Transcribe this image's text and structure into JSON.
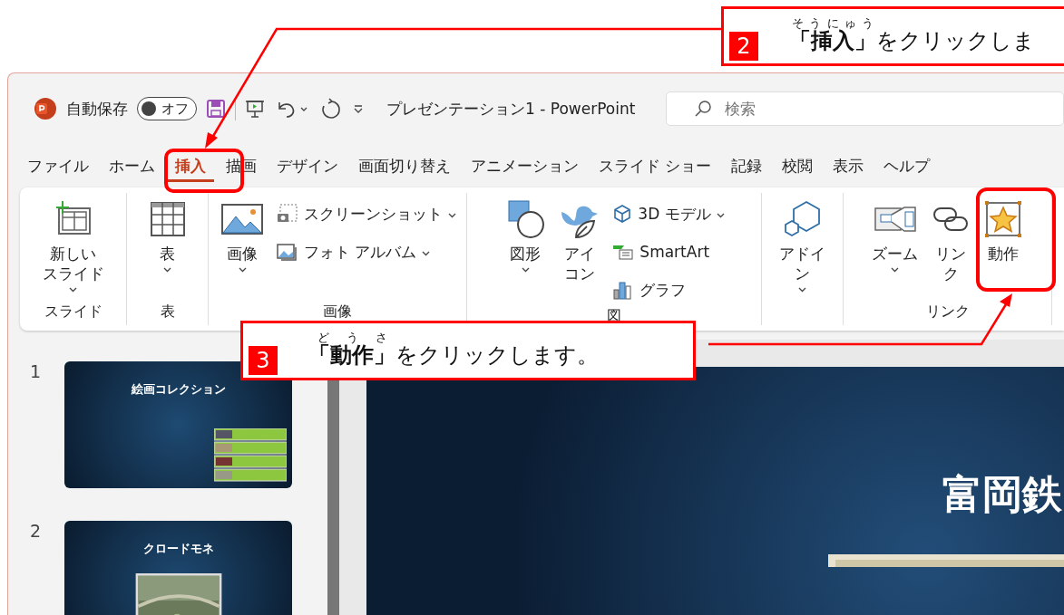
{
  "callouts": [
    {
      "number": "2",
      "ruby": "そうにゅう",
      "target": "「挿入」",
      "text": "をクリックしま"
    },
    {
      "number": "3",
      "ruby": "どうさ",
      "target": "「動作」",
      "text": "をクリックします。"
    }
  ],
  "title_bar": {
    "autosave_label": "自動保存",
    "autosave_toggle": {
      "label": "オフ",
      "on": false
    },
    "title": "プレゼンテーション1 - PowerPoint",
    "search": {
      "placeholder": "検索"
    }
  },
  "tabs": [
    {
      "label": "ファイル",
      "selected": false
    },
    {
      "label": "ホーム",
      "selected": false
    },
    {
      "label": "挿入",
      "selected": true
    },
    {
      "label": "描画",
      "selected": false
    },
    {
      "label": "デザイン",
      "selected": false
    },
    {
      "label": "画面切り替え",
      "selected": false
    },
    {
      "label": "アニメーション",
      "selected": false
    },
    {
      "label": "スライド ショー",
      "selected": false
    },
    {
      "label": "記録",
      "selected": false
    },
    {
      "label": "校閲",
      "selected": false
    },
    {
      "label": "表示",
      "selected": false
    },
    {
      "label": "ヘルプ",
      "selected": false
    }
  ],
  "ribbon": {
    "groups": [
      {
        "label": "スライド",
        "items": [
          {
            "kind": "large",
            "lines": [
              "新しい",
              "スライド"
            ],
            "dropdown": true
          }
        ]
      },
      {
        "label": "表",
        "items": [
          {
            "kind": "large",
            "lines": [
              "表"
            ],
            "dropdown": true
          }
        ]
      },
      {
        "label": "画像",
        "items": [
          {
            "kind": "large",
            "lines": [
              "画像"
            ],
            "dropdown": true
          },
          {
            "kind": "small",
            "lines": [
              "スクリーンショット"
            ],
            "dropdown": true
          },
          {
            "kind": "small",
            "lines": [
              "フォト アルバム"
            ],
            "dropdown": true
          }
        ]
      },
      {
        "label": "図",
        "items": [
          {
            "kind": "large",
            "lines": [
              "図形"
            ],
            "dropdown": true
          },
          {
            "kind": "large",
            "lines": [
              "アイ",
              "コン"
            ],
            "dropdown": false
          },
          {
            "kind": "small",
            "lines": [
              "3D モデル"
            ],
            "dropdown": true
          },
          {
            "kind": "small",
            "lines": [
              "SmartArt"
            ],
            "dropdown": false
          },
          {
            "kind": "small",
            "lines": [
              "グラフ"
            ],
            "dropdown": false
          }
        ]
      },
      {
        "items": [
          {
            "kind": "large",
            "lines": [
              "アドイ",
              "ン"
            ],
            "dropdown": true
          }
        ]
      },
      {
        "label": "リンク",
        "items": [
          {
            "kind": "large",
            "lines": [
              "ズーム"
            ],
            "dropdown": true
          },
          {
            "kind": "large",
            "lines": [
              "リン",
              "ク"
            ],
            "dropdown": false
          },
          {
            "kind": "large",
            "lines": [
              "動作"
            ],
            "dropdown": false
          }
        ]
      }
    ]
  },
  "slides": [
    {
      "number": "1",
      "title": "絵画コレクション",
      "kind": "menu"
    },
    {
      "number": "2",
      "title": "クロードモネ",
      "kind": "picture"
    }
  ],
  "editor": {
    "title": "富岡鉄"
  }
}
